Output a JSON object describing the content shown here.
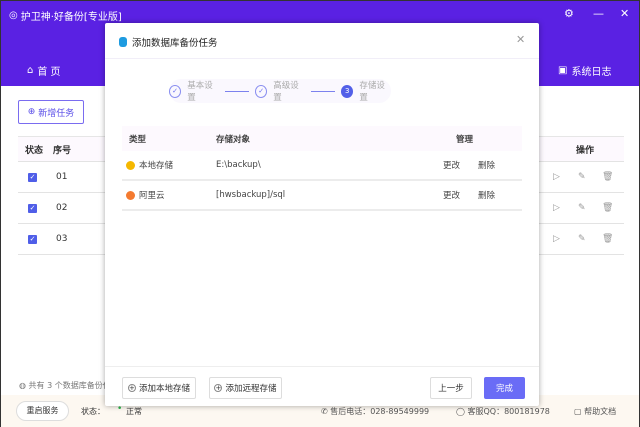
{
  "app": {
    "title": "护卫神·好备份[专业版]",
    "controls": [
      "gear-icon",
      "minimize-icon",
      "close-icon"
    ],
    "nav": {
      "home": "首 页",
      "logs": "系统日志"
    },
    "new_task": "新增任务",
    "table": {
      "headers": {
        "status": "状态",
        "index": "序号",
        "actions": "操作"
      },
      "rows": [
        {
          "checked": true,
          "index": "01"
        },
        {
          "checked": true,
          "index": "02"
        },
        {
          "checked": true,
          "index": "03"
        }
      ]
    },
    "summary": "共有 3 个数据库备份任",
    "statusbar": {
      "restart": "重启服务",
      "status_label": "状态：",
      "status_value": "正常",
      "phone": "售后电话：028-89549999",
      "qq": "客服QQ：800181978",
      "help": "帮助文档"
    },
    "accent": "#5a21e3"
  },
  "modal": {
    "title": "添加数据库备份任务",
    "steps": [
      {
        "label": "基本设置",
        "state": "done"
      },
      {
        "label": "高级设置",
        "state": "done"
      },
      {
        "label": "存储设置",
        "num": "3",
        "state": "current"
      }
    ],
    "table": {
      "headers": [
        "类型",
        "存储对象",
        "管理"
      ],
      "rows": [
        {
          "type": "本地存储",
          "target": "E:\\backup\\",
          "edit": "更改",
          "del": "删除",
          "color": "#f5b800"
        },
        {
          "type": "阿里云",
          "target": "[hwsbackup]/sql",
          "edit": "更改",
          "del": "删除",
          "color": "#f47a30"
        }
      ]
    },
    "add_local": "添加本地存储",
    "add_remote": "添加远程存储",
    "prev": "上一步",
    "finish": "完成",
    "finish_color": "#6a6cf6"
  }
}
